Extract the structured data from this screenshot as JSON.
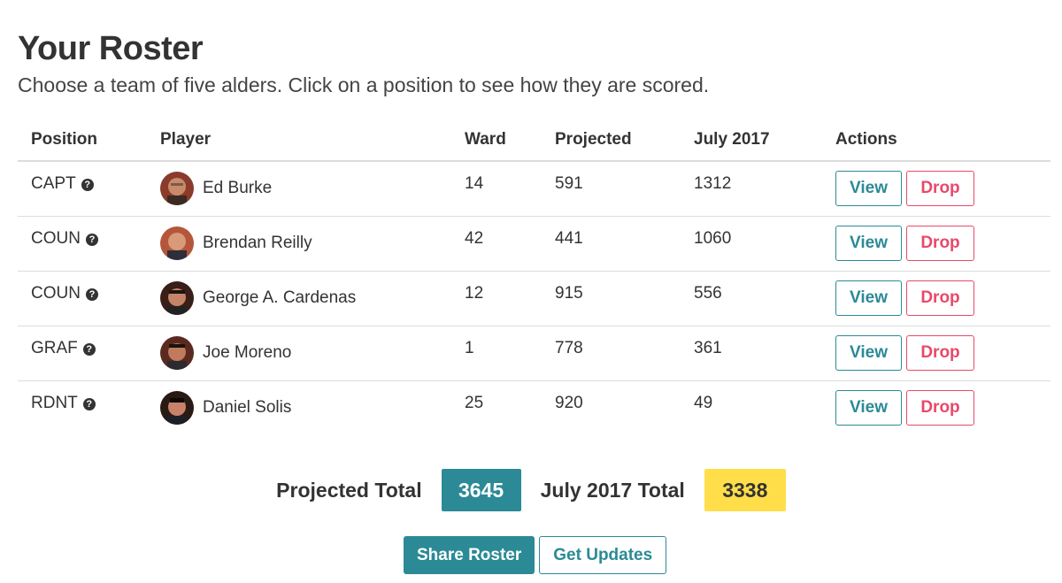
{
  "header": {
    "title": "Your Roster",
    "subtitle": "Choose a team of five alders. Click on a position to see how they are scored."
  },
  "table": {
    "columns": [
      "Position",
      "Player",
      "Ward",
      "Projected",
      "July 2017",
      "Actions"
    ],
    "help_icon": "?",
    "view_label": "View",
    "drop_label": "Drop",
    "rows": [
      {
        "position": "CAPT",
        "player": "Ed Burke",
        "ward": "14",
        "projected": "591",
        "july": "1312",
        "avatar_icon": "player-photo-icon"
      },
      {
        "position": "COUN",
        "player": "Brendan Reilly",
        "ward": "42",
        "projected": "441",
        "july": "1060",
        "avatar_icon": "player-photo-icon"
      },
      {
        "position": "COUN",
        "player": "George A. Cardenas",
        "ward": "12",
        "projected": "915",
        "july": "556",
        "avatar_icon": "player-photo-icon"
      },
      {
        "position": "GRAF",
        "player": "Joe Moreno",
        "ward": "1",
        "projected": "778",
        "july": "361",
        "avatar_icon": "player-photo-icon"
      },
      {
        "position": "RDNT",
        "player": "Daniel Solis",
        "ward": "25",
        "projected": "920",
        "july": "49",
        "avatar_icon": "player-photo-icon"
      }
    ]
  },
  "totals": {
    "projected_label": "Projected Total",
    "projected_value": "3645",
    "july_label": "July 2017 Total",
    "july_value": "3338"
  },
  "actions": {
    "share_label": "Share Roster",
    "updates_label": "Get Updates"
  },
  "colors": {
    "accent": "#2b8a96",
    "danger": "#e8496a",
    "highlight": "#ffde4a",
    "text": "#333333"
  }
}
